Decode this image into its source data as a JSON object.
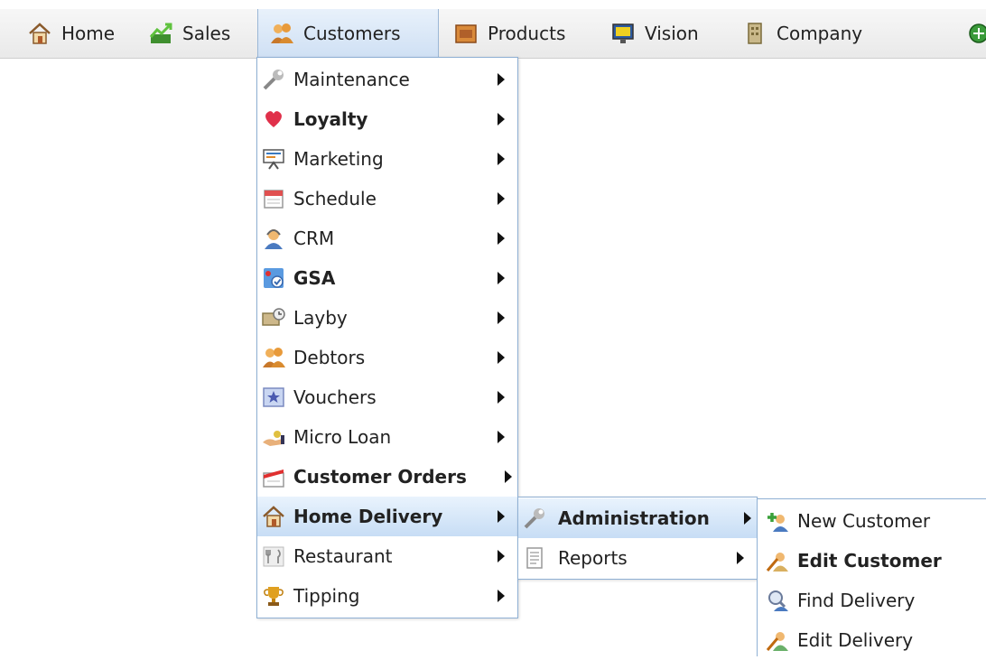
{
  "nav": {
    "items": [
      {
        "label": "Home",
        "icon": "house-icon"
      },
      {
        "label": "Sales",
        "icon": "chart-up-icon"
      },
      {
        "label": "Customers",
        "icon": "people-icon"
      },
      {
        "label": "Products",
        "icon": "box-icon"
      },
      {
        "label": "Vision",
        "icon": "monitor-icon"
      },
      {
        "label": "Company",
        "icon": "building-icon"
      }
    ]
  },
  "customers_menu": {
    "items": [
      {
        "label": "Maintenance",
        "icon": "wrench-icon",
        "bold": false
      },
      {
        "label": "Loyalty",
        "icon": "heart-balloon-icon",
        "bold": true
      },
      {
        "label": "Marketing",
        "icon": "presentation-board-icon",
        "bold": false
      },
      {
        "label": "Schedule",
        "icon": "calendar-icon",
        "bold": false
      },
      {
        "label": "CRM",
        "icon": "headset-person-icon",
        "bold": false
      },
      {
        "label": "GSA",
        "icon": "map-check-icon",
        "bold": true
      },
      {
        "label": "Layby",
        "icon": "layby-clock-icon",
        "bold": false
      },
      {
        "label": "Debtors",
        "icon": "people-icon",
        "bold": false
      },
      {
        "label": "Vouchers",
        "icon": "voucher-star-icon",
        "bold": false
      },
      {
        "label": "Micro Loan",
        "icon": "hand-coins-icon",
        "bold": false
      },
      {
        "label": "Customer Orders",
        "icon": "order-box-icon",
        "bold": true
      },
      {
        "label": "Home Delivery",
        "icon": "house-icon",
        "bold": true
      },
      {
        "label": "Restaurant",
        "icon": "cutlery-icon",
        "bold": false
      },
      {
        "label": "Tipping",
        "icon": "trophy-icon",
        "bold": false
      }
    ]
  },
  "home_delivery_menu": {
    "items": [
      {
        "label": "Administration",
        "icon": "wrench-icon",
        "bold": true
      },
      {
        "label": "Reports",
        "icon": "report-page-icon",
        "bold": false
      }
    ]
  },
  "administration_menu": {
    "items": [
      {
        "label": "New Customer",
        "icon": "add-person-icon",
        "bold": false
      },
      {
        "label": "Edit Customer",
        "icon": "edit-person-icon",
        "bold": true
      },
      {
        "label": "Find Delivery",
        "icon": "search-person-icon",
        "bold": false
      },
      {
        "label": "Edit Delivery",
        "icon": "edit-person-icon",
        "bold": false
      }
    ]
  }
}
